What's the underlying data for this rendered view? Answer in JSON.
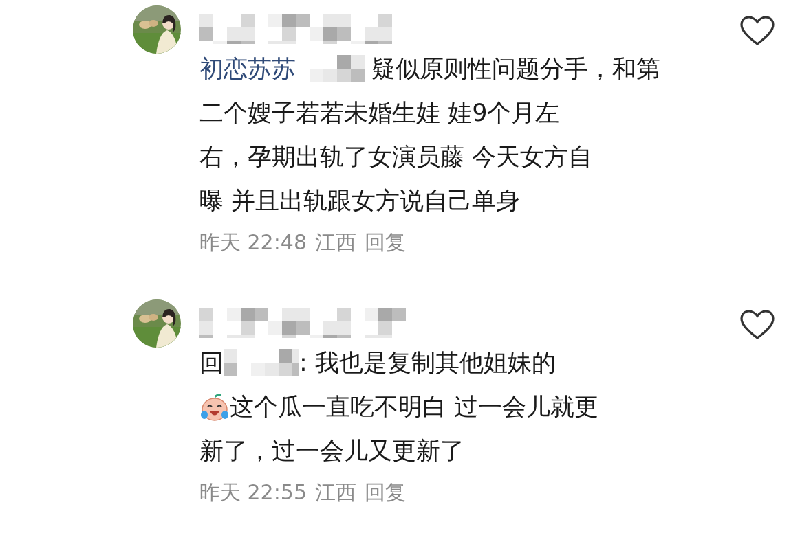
{
  "comments": [
    {
      "avatar": {
        "kind": "picture"
      },
      "name_redacted": true,
      "liked": false,
      "lines": [
        [
          {
            "kind": "mention",
            "text": "初恋苏苏"
          },
          {
            "kind": "redacted"
          },
          {
            "kind": "text",
            "text": "疑似原则性问题分手，和第"
          }
        ],
        [
          {
            "kind": "text",
            "text": "二个嫂子若若未婚生娃 娃9个月左"
          }
        ],
        [
          {
            "kind": "text",
            "text": "右，孕期出轨了女演员藤 今天女方自"
          }
        ],
        [
          {
            "kind": "text",
            "text": "曝 并且出轨跟女方说自己单身"
          }
        ]
      ],
      "time": "昨天 22:48",
      "location": "江西",
      "reply": "回复"
    },
    {
      "avatar": {
        "kind": "picture"
      },
      "name_redacted": true,
      "liked": false,
      "lines": [
        [
          {
            "kind": "text",
            "text": "回"
          },
          {
            "kind": "redacted"
          },
          {
            "kind": "text",
            "text": ": 我也是复制其他姐妹的"
          }
        ],
        [
          {
            "kind": "emoji"
          },
          {
            "kind": "text",
            "text": "这个瓜一直吃不明白 过一会儿就更"
          }
        ],
        [
          {
            "kind": "text",
            "text": "新了，过一会儿又更新了"
          }
        ]
      ],
      "time": "昨天 22:55",
      "location": "江西",
      "reply": "回复"
    }
  ]
}
